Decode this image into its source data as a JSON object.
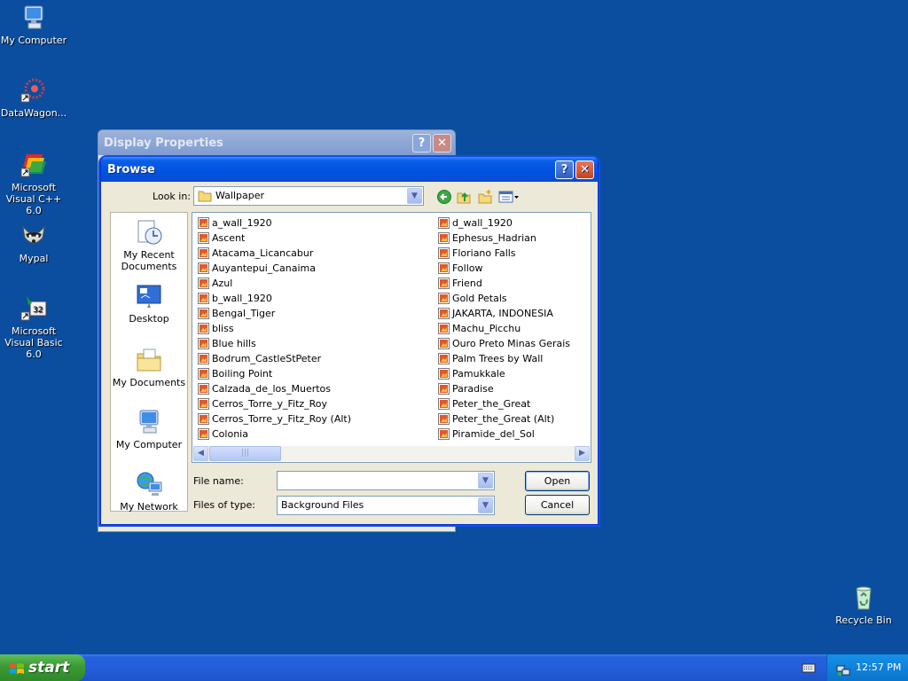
{
  "desktop": {
    "icons": [
      {
        "label": "My Computer"
      },
      {
        "label": "DataWagon..."
      },
      {
        "label": "Microsoft Visual C++ 6.0"
      },
      {
        "label": "Mypal"
      },
      {
        "label": "Microsoft Visual Basic 6.0"
      },
      {
        "label": "Recycle Bin"
      }
    ]
  },
  "display_properties": {
    "title": "Display Properties",
    "help_label": "?",
    "close_label": "✕"
  },
  "browse": {
    "title": "Browse",
    "help_label": "?",
    "close_label": "✕",
    "look_in_label": "Look in:",
    "look_in_value": "Wallpaper",
    "places": [
      {
        "label": "My Recent Documents"
      },
      {
        "label": "Desktop"
      },
      {
        "label": "My Documents"
      },
      {
        "label": "My Computer"
      },
      {
        "label": "My Network"
      }
    ],
    "files_col1": [
      "a_wall_1920",
      "Ascent",
      "Atacama_Licancabur",
      "Auyantepui_Canaima",
      "Azul",
      "b_wall_1920",
      "Bengal_Tiger",
      "bliss",
      "Blue hills",
      "Bodrum_CastleStPeter",
      "Boiling Point",
      "Calzada_de_los_Muertos",
      "Cerros_Torre_y_Fitz_Roy",
      "Cerros_Torre_y_Fitz_Roy (Alt)",
      "Colonia"
    ],
    "files_col2": [
      "d_wall_1920",
      "Ephesus_Hadrian",
      "Floriano Falls",
      "Follow",
      "Friend",
      "Gold Petals",
      "JAKARTA, INDONESIA",
      "Machu_Picchu",
      "Ouro Preto Minas Gerais",
      "Palm Trees by Wall",
      "Pamukkale",
      "Paradise",
      "Peter_the_Great",
      "Peter_the_Great (Alt)",
      "Piramide_del_Sol"
    ],
    "file_name_label": "File name:",
    "file_name_value": "",
    "files_of_type_label": "Files of type:",
    "files_of_type_value": "Background Files",
    "open_label": "Open",
    "cancel_label": "Cancel"
  },
  "taskbar": {
    "start_label": "start",
    "clock": "12:57 PM"
  }
}
